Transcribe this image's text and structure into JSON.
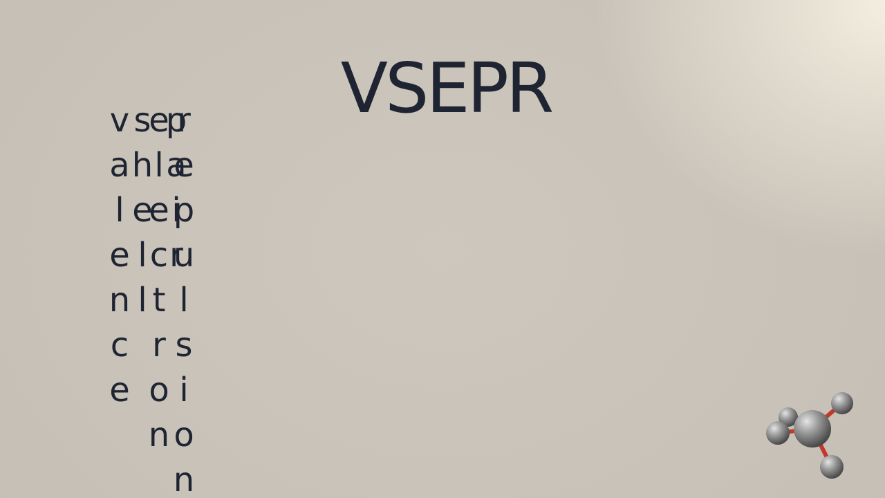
{
  "title": "VSEPR",
  "words": [
    "valence",
    "shell",
    "electron",
    "pair",
    "repulsion"
  ],
  "colors": {
    "text": "#1e2431",
    "background": "#c9c3b9",
    "atom": "#8e8e8e",
    "bond": "#c0392b"
  },
  "molecule_icon": "tetrahedral-molecule-icon"
}
